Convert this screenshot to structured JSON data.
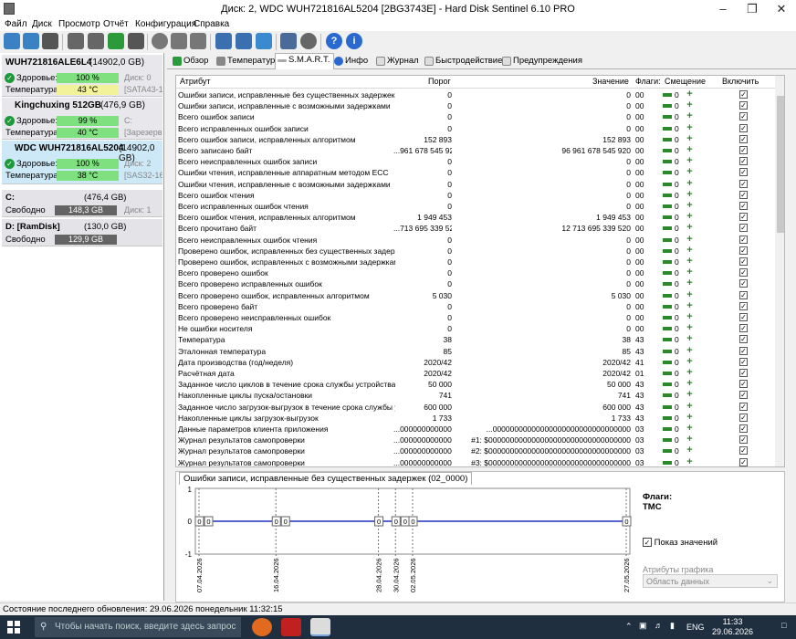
{
  "window": {
    "title": "Диск: 2, WDC    WUH721816AL5204 [2BG3743E]  -  Hard Disk Sentinel 6.10 PRO"
  },
  "menu": [
    "Файл",
    "Диск",
    "Просмотр",
    "Отчёт",
    "Конфигурация",
    "Справка"
  ],
  "disks": [
    {
      "name": "WUH721816ALE6L4",
      "size": "(14902,0 GB)",
      "health_label": "Здоровье:",
      "health": "100 %",
      "health_pct": 100,
      "disk_label": "Диск: 0",
      "temp_label": "Температура:",
      "temp": "43 °C",
      "iface": "[SATA43-16tb",
      "temp_color": "yellow"
    },
    {
      "name": "Kingchuxing 512GB",
      "size": "(476,9 GB)",
      "health_label": "Здоровье:",
      "health": "99 %",
      "health_pct": 99,
      "disk_label": "C:",
      "temp_label": "Температура:",
      "temp": "40 °C",
      "iface": "[Зарезерви",
      "temp_color": "green"
    },
    {
      "name": "WDC     WUH721816AL5204",
      "size": "(14902,0 GB)",
      "health_label": "Здоровье:",
      "health": "100 %",
      "health_pct": 100,
      "disk_label": "Диск: 2",
      "temp_label": "Температура:",
      "temp": "38 °C",
      "iface": "[SAS32-16tb",
      "temp_color": "green"
    }
  ],
  "volumes": [
    {
      "name": "C:",
      "size": "(476,4 GB)",
      "free_label": "Свободно",
      "free": "148,3 GB",
      "disk": "Диск: 1"
    },
    {
      "name": "D: [RamDisk]",
      "size": "(130,0 GB)",
      "free_label": "Свободно",
      "free": "129,9 GB",
      "disk": ""
    }
  ],
  "tabs": [
    "Обзор",
    "Температура",
    "S.M.A.R.T.",
    "Инфо",
    "Журнал",
    "Быстродействие",
    "Предупреждения"
  ],
  "table": {
    "headers": {
      "attr": "Атрибут",
      "thr": "Порог",
      "val": "Значение",
      "flags": "Флаги:",
      "offset": "Смещение",
      "enable": "Включить"
    },
    "rows": [
      [
        "Ошибки записи, исправленные без существенных задержек",
        "0",
        "0",
        "00"
      ],
      [
        "Ошибки записи, исправленные с возможными задержками",
        "0",
        "0",
        "00"
      ],
      [
        "Всего ошибок записи",
        "0",
        "0",
        "00"
      ],
      [
        "Всего исправленных ошибок записи",
        "0",
        "0",
        "00"
      ],
      [
        "Всего ошибок записи, исправленных алгоритмом",
        "152 893",
        "152 893",
        "00"
      ],
      [
        "Всего записано байт",
        "...961 678 545 920",
        "96 961 678 545 920",
        "00"
      ],
      [
        "Всего неисправленных ошибок записи",
        "0",
        "0",
        "00"
      ],
      [
        "Ошибки чтения, исправленные аппаратным методом ECC",
        "0",
        "0",
        "00"
      ],
      [
        "Ошибки чтения, исправленные с возможными задержками",
        "0",
        "0",
        "00"
      ],
      [
        "Всего ошибок чтения",
        "0",
        "0",
        "00"
      ],
      [
        "Всего исправленных ошибок чтения",
        "0",
        "0",
        "00"
      ],
      [
        "Всего ошибок чтения, исправленных алгоритмом",
        "1 949 453",
        "1 949 453",
        "00"
      ],
      [
        "Всего прочитано байт",
        "...713 695 339 520",
        "12 713 695 339 520",
        "00"
      ],
      [
        "Всего неисправленных ошибок чтения",
        "0",
        "0",
        "00"
      ],
      [
        "Проверено ошибок, исправленных без существенных задержек",
        "0",
        "0",
        "00"
      ],
      [
        "Проверено ошибок, исправленных с возможными задержками",
        "0",
        "0",
        "00"
      ],
      [
        "Всего проверено ошибок",
        "0",
        "0",
        "00"
      ],
      [
        "Всего проверено исправленных ошибок",
        "0",
        "0",
        "00"
      ],
      [
        "Всего проверено ошибок, исправленных алгоритмом",
        "5 030",
        "5 030",
        "00"
      ],
      [
        "Всего проверено байт",
        "0",
        "0",
        "00"
      ],
      [
        "Всего проверено неисправленных ошибок",
        "0",
        "0",
        "00"
      ],
      [
        "Не ошибки носителя",
        "0",
        "0",
        "00"
      ],
      [
        "Температура",
        "38",
        "38",
        "43"
      ],
      [
        "Эталонная температура",
        "85",
        "85",
        "43"
      ],
      [
        "Дата производства (год/неделя)",
        "2020/42",
        "2020/42",
        "41"
      ],
      [
        "Расчётная дата",
        "2020/42",
        "2020/42",
        "01"
      ],
      [
        "Заданное число циклов в течение срока службы устройства",
        "50 000",
        "50 000",
        "43"
      ],
      [
        "Накопленные циклы пуска/остановки",
        "741",
        "741",
        "43"
      ],
      [
        "Заданное число загрузок-выгрузок в течение срока службы уст...",
        "600 000",
        "600 000",
        "43"
      ],
      [
        "Накопленные циклы загрузок-выгрузок",
        "1 733",
        "1 733",
        "43"
      ],
      [
        "Данные параметров клиента приложения",
        "...0000000000000",
        "...00000000000000000000000000000000",
        "03"
      ],
      [
        "Журнал результатов самопроверки",
        "...0000000000000",
        "#1: $000000000000000000000000000000000",
        "03"
      ],
      [
        "Журнал результатов самопроверки",
        "...0000000000000",
        "#2: $000000000000000000000000000000000",
        "03"
      ],
      [
        "Журнал результатов самопроверки",
        "...0000000000000",
        "#3: $000000000000000000000000000000000",
        "03"
      ]
    ]
  },
  "chart": {
    "tab": "Ошибки записи, исправленные без существенных задержек (02_0000)",
    "yticks": [
      "1",
      "0",
      "-1"
    ],
    "dates": [
      "07.04.2026",
      "16.04.2026",
      "28.04.2026",
      "30.04.2026",
      "02.05.2026",
      "27.05.2026"
    ],
    "flags_label": "Флаги:",
    "flags_value": "TMC",
    "show_values": "Показ значений",
    "graph_attr": "Атрибуты графика",
    "area_select": "Область данных"
  },
  "chart_data": {
    "type": "line",
    "title": "Ошибки записи, исправленные без существенных задержек (02_0000)",
    "x": [
      "07.04.2026",
      "07.04.2026",
      "16.04.2026",
      "16.04.2026",
      "28.04.2026",
      "30.04.2026",
      "30.04.2026",
      "02.05.2026",
      "27.05.2026"
    ],
    "series": [
      {
        "values": [
          0,
          0,
          0,
          0,
          0,
          0,
          0,
          0,
          0
        ]
      }
    ],
    "ylim": [
      -1,
      1
    ]
  },
  "status": "Состояние последнего обновления: 29.06.2026 понедельник 11:32:15",
  "taskbar": {
    "search": "Чтобы начать поиск, введите здесь запрос",
    "lang": "ENG",
    "time": "11:33",
    "date": "29.06.2026"
  }
}
